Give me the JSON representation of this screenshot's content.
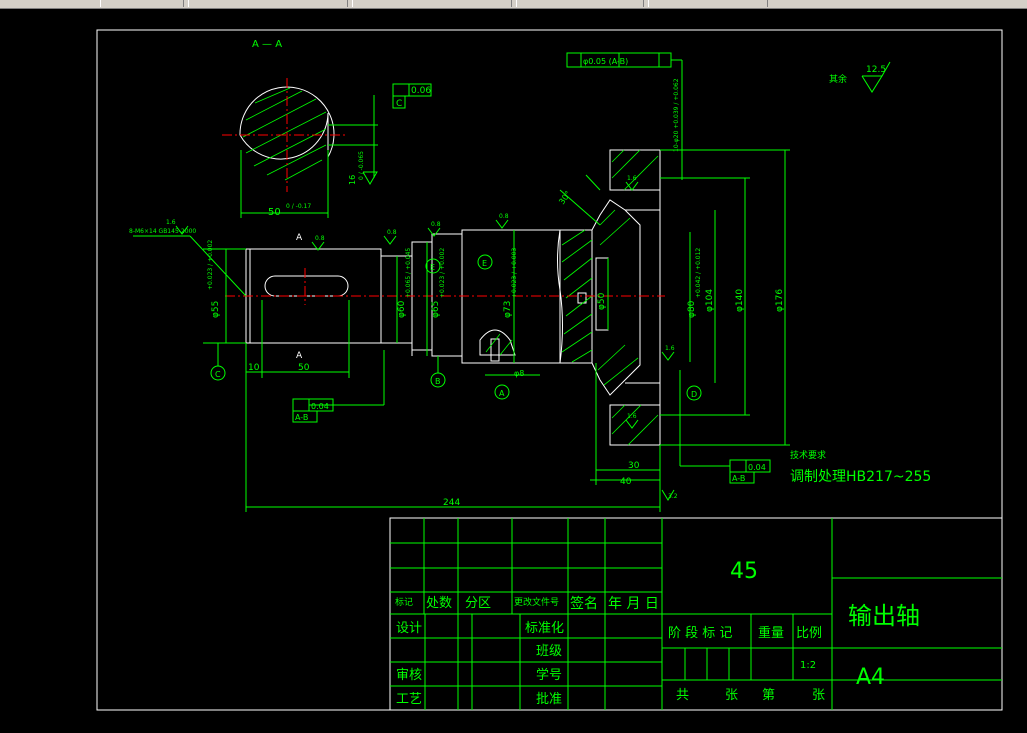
{
  "colors": {
    "background": "#000000",
    "frame": "#ffffff",
    "dimension": "#00ff00",
    "centerline": "#ff0000"
  },
  "section": {
    "label": "A — A",
    "width_dim": "50",
    "width_tol": "0 / -0.17",
    "flat_tol": "0.06",
    "flat_datum": "C",
    "depth_tol": "0 / -0.065",
    "depth_dim": "16"
  },
  "shaft": {
    "key_note": "8-M6×14  GB145-2000",
    "diameters": [
      "φ55",
      "φ60",
      "φ65",
      "φ73",
      "φ50",
      "φ80",
      "φ104",
      "φ140",
      "φ176"
    ],
    "tol_55": "+0.023 / +0.002",
    "tol_60": "+0.065 / +0.045",
    "tol_65": "+0.023 / +0.002",
    "tol_73": "+0.023 / +0.003",
    "tol_80": "+0.042 / +0.012",
    "tol_top": "10-φ20  +0.039 / +0.062",
    "len_10": "10",
    "len_50": "50",
    "len_30": "30",
    "len_40": "40",
    "len_244": "244",
    "len_8": "φ8",
    "datums": [
      "A",
      "B",
      "C",
      "D",
      "E"
    ],
    "roughness": [
      "1.6",
      "0.8",
      "3.2"
    ],
    "runout": "0.04",
    "runout_ref": "A-B",
    "position_tol": "φ0.05 (A-B)",
    "angle": "30°",
    "section_marks": [
      "A",
      "A"
    ]
  },
  "notes": {
    "rest": "其余",
    "rest_roughness": "12.5",
    "tech_title": "技术要求",
    "tech_line": "调制处理HB217~255"
  },
  "title_block": {
    "material": "45",
    "part_name": "输出轴",
    "sheet_size": "A4",
    "scale": "1:2",
    "rev_headers": [
      "标记",
      "处数",
      "分区",
      "更改文件号",
      "签名",
      "年 月 日"
    ],
    "left_labels": [
      "设计",
      "审核",
      "工艺"
    ],
    "mid_labels": [
      "标准化",
      "班级",
      "学号",
      "批准"
    ],
    "stage": [
      "阶 段 标 记",
      "重量",
      "比例"
    ],
    "sheet_labels": [
      "共",
      "张",
      "第",
      "张"
    ]
  }
}
